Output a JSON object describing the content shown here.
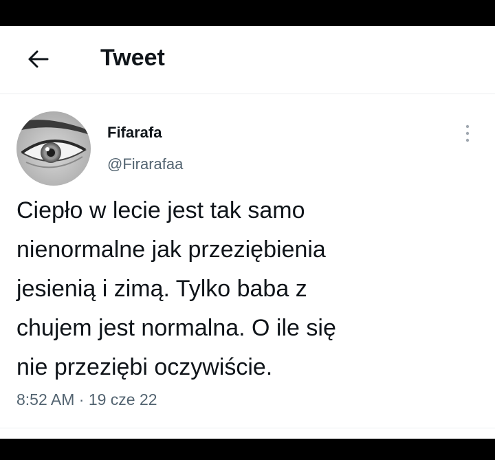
{
  "header": {
    "title": "Tweet",
    "back_icon": "arrow-left-icon"
  },
  "tweet": {
    "author": {
      "display_name": "Fifarafa",
      "handle": "@Firarafaa",
      "avatar_icon": "eye-avatar"
    },
    "more_icon": "vertical-ellipsis-icon",
    "text": "Ciepło w lecie jest tak samo\nnienormalne jak przeziębienia\njesienią i zimą. Tylko baba z\nchujem jest normalna. O ile się\nnie przeziębi oczywiście.",
    "timestamp": "8:52 AM · 19 cze 22"
  },
  "colors": {
    "text_primary": "#0f1419",
    "text_secondary": "#536471",
    "divider": "#eceff1",
    "letterbox": "#000000"
  }
}
